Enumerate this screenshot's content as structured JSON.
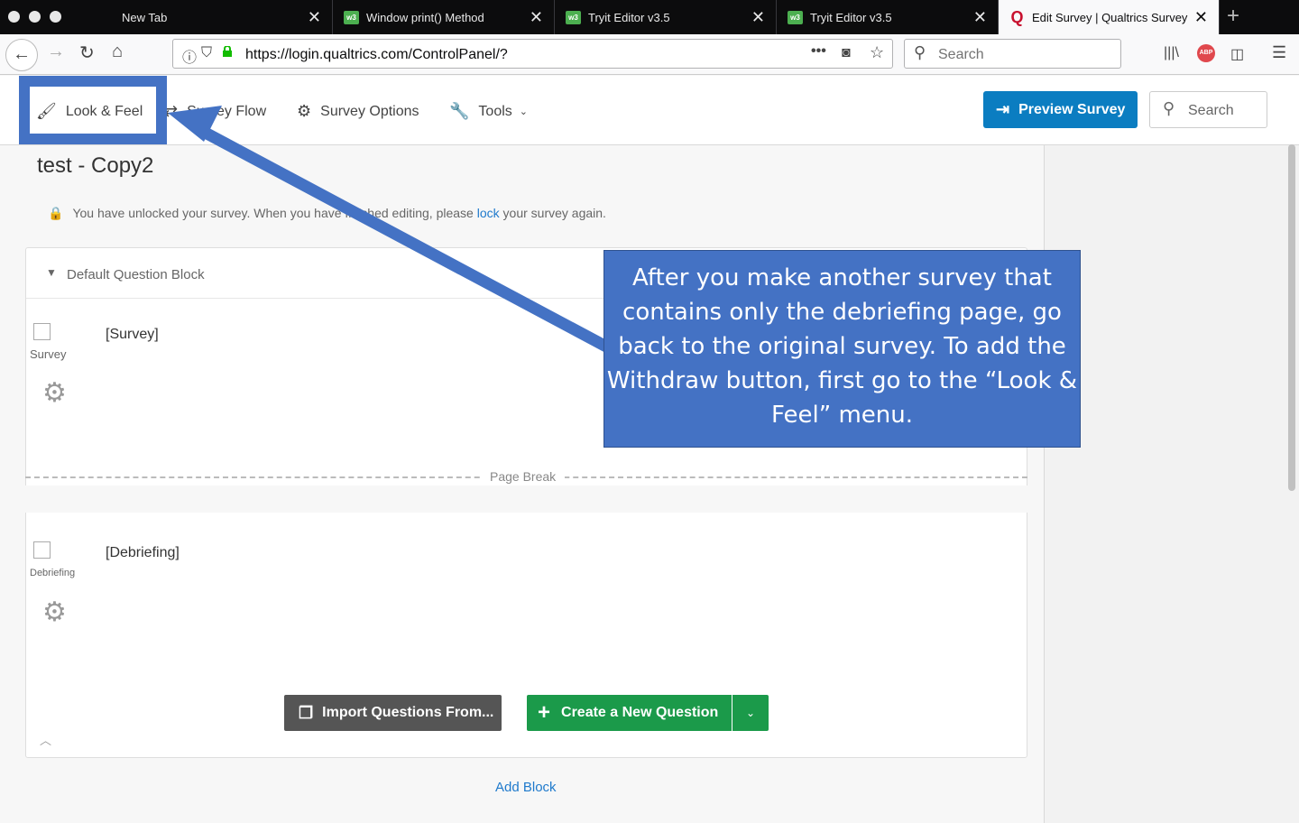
{
  "browser": {
    "tabs": [
      {
        "title": "New Tab",
        "favicon": "none",
        "active": false
      },
      {
        "title": "Window print() Method",
        "favicon": "w3schools-icon",
        "active": false
      },
      {
        "title": "Tryit Editor v3.5",
        "favicon": "w3schools-icon",
        "active": false
      },
      {
        "title": "Tryit Editor v3.5",
        "favicon": "w3schools-icon",
        "active": false
      },
      {
        "title": "Edit Survey | Qualtrics Survey",
        "favicon": "qualtrics-icon",
        "active": true
      }
    ],
    "url": "https://login.qualtrics.com/ControlPanel/?",
    "search_placeholder": "Search",
    "favicon_w3": "w3",
    "favicon_q": "Q"
  },
  "toolbar": {
    "look_feel": "Look & Feel",
    "survey_flow": "Survey Flow",
    "survey_options": "Survey Options",
    "tools": "Tools",
    "preview": "Preview Survey",
    "search_placeholder": "Search"
  },
  "survey": {
    "title": "test - Copy2",
    "unlock_pre": "You have unlocked your survey. When you have finished editing, please ",
    "unlock_link": "lock",
    "unlock_post": " your survey again.",
    "block_title": "Default Question Block",
    "questions": [
      {
        "label": "Survey",
        "text": "[Survey]"
      },
      {
        "label": "Debriefing",
        "text": "[Debriefing]"
      }
    ],
    "page_break": "Page Break",
    "import_label": "Import Questions From...",
    "create_label": "Create a New Question",
    "add_block": "Add Block"
  },
  "annotation": {
    "text": "After you make another survey that contains only the debriefing page, go back to the original survey.  To add the Withdraw button, first go to the “Look & Feel” menu.",
    "color": "#4472c4"
  },
  "colors": {
    "preview_button": "#0b7dc1",
    "create_button": "#1b9a4a",
    "link": "#1f7acc"
  }
}
